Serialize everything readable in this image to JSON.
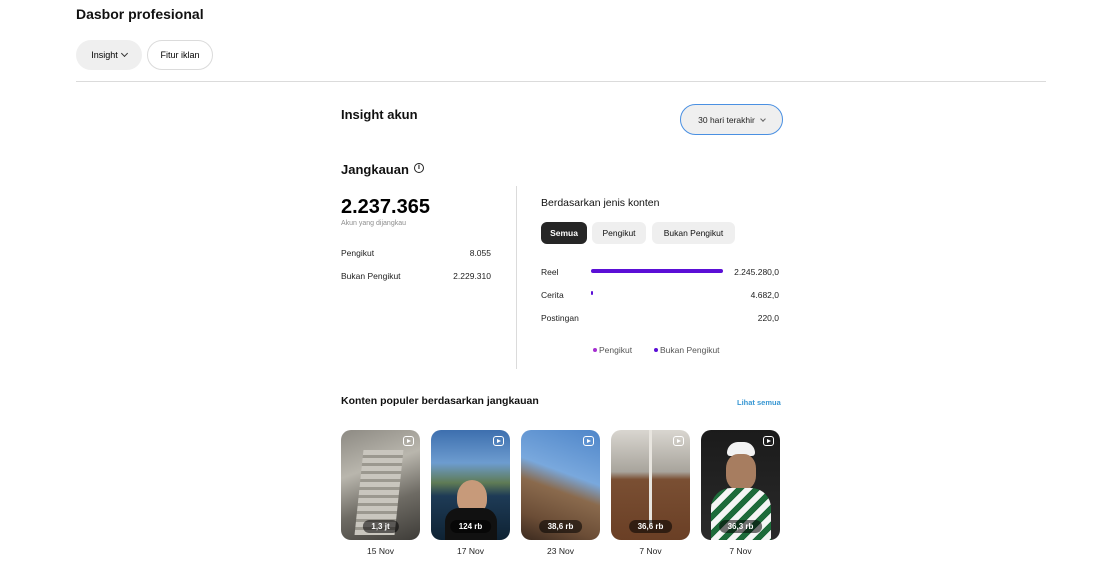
{
  "header": {
    "title": "Dasbor profesional",
    "chips": [
      {
        "label": "Insight"
      },
      {
        "label": "Fitur iklan"
      }
    ]
  },
  "insight": {
    "title": "Insight akun",
    "date_range": "30 hari terakhir"
  },
  "reach": {
    "title": "Jangkauan",
    "info_glyph": "i",
    "total": "2.237.365",
    "total_label": "Akun yang dijangkau",
    "stats": [
      {
        "label": "Pengikut",
        "value": "8.055"
      },
      {
        "label": "Bukan Pengikut",
        "value": "2.229.310"
      }
    ]
  },
  "breakdown": {
    "title": "Berdasarkan jenis konten",
    "tabs": [
      {
        "label": "Semua",
        "active": true
      },
      {
        "label": "Pengikut",
        "active": false
      },
      {
        "label": "Bukan Pengikut",
        "active": false
      }
    ],
    "rows": [
      {
        "label": "Reel",
        "value": "2.245.280,0",
        "fraction": 1.0
      },
      {
        "label": "Cerita",
        "value": "4.682,0",
        "fraction": 0.0021
      },
      {
        "label": "Postingan",
        "value": "220,0",
        "fraction": 0.0001
      }
    ],
    "legend": [
      {
        "label": "Pengikut",
        "color": "#a52fd1"
      },
      {
        "label": "Bukan Pengikut",
        "color": "#5b0fd6"
      }
    ],
    "bar_color": "#5b0fd6"
  },
  "popular": {
    "title": "Konten populer berdasarkan jangkauan",
    "see_all": "Lihat semua",
    "items": [
      {
        "views": "1,3 jt",
        "date": "15 Nov",
        "icon": "reel-icon"
      },
      {
        "views": "124 rb",
        "date": "17 Nov",
        "icon": "reel-icon"
      },
      {
        "views": "38,6 rb",
        "date": "23 Nov",
        "icon": "reel-icon"
      },
      {
        "views": "36,6 rb",
        "date": "7 Nov",
        "icon": "reel-icon"
      },
      {
        "views": "36,3 rb",
        "date": "7 Nov",
        "icon": "reel-icon"
      }
    ]
  }
}
